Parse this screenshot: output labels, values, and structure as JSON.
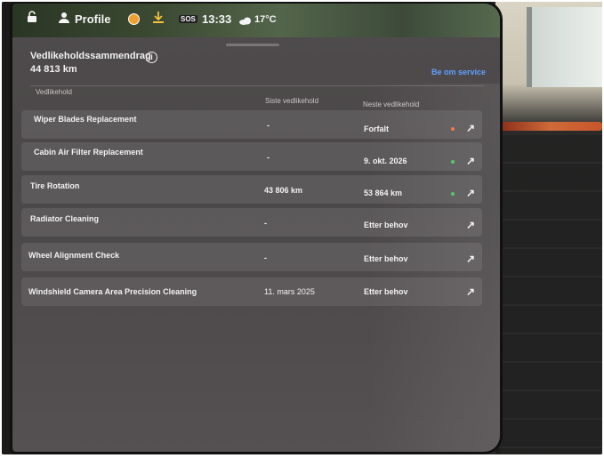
{
  "status_bar": {
    "profile_label": "Profile",
    "time": "13:33",
    "temperature": "17°C",
    "badge": "SOS"
  },
  "summary": {
    "title": "Vedlikeholdssammendrag",
    "odometer": "44 813 km",
    "service_link": "Be om service"
  },
  "table": {
    "headers": [
      "Vedlikehold",
      "Siste vedlikehold",
      "Neste vedlikehold"
    ],
    "rows": [
      {
        "name": "Wiper Blades Replacement",
        "last": "-",
        "next": "Forfalt",
        "status_color": "#e8753a"
      },
      {
        "name": "Cabin Air Filter Replacement",
        "last": "-",
        "next": "9. okt. 2026",
        "status_color": "#4cc46a"
      },
      {
        "name": "Tire Rotation",
        "last": "43 806 km",
        "next": "53 864 km",
        "status_color": "#4cc46a"
      },
      {
        "name": "Radiator Cleaning",
        "last": "-",
        "next": "Etter behov",
        "status_color": ""
      },
      {
        "name": "Wheel Alignment Check",
        "last": "-",
        "next": "Etter behov",
        "status_color": ""
      },
      {
        "name": "Windshield Camera Area Precision Cleaning",
        "last": "11. mars 2025",
        "next": "Etter behov",
        "status_color": ""
      }
    ]
  },
  "icons": {
    "lock": "lock-icon",
    "profile": "person-icon",
    "download": "download-icon",
    "weather": "cloud-icon",
    "info": "info-icon",
    "open": "arrow-up-right-icon"
  },
  "colors": {
    "accent": "#5fa0ff",
    "overdue": "#e8753a",
    "ok": "#4cc46a"
  }
}
